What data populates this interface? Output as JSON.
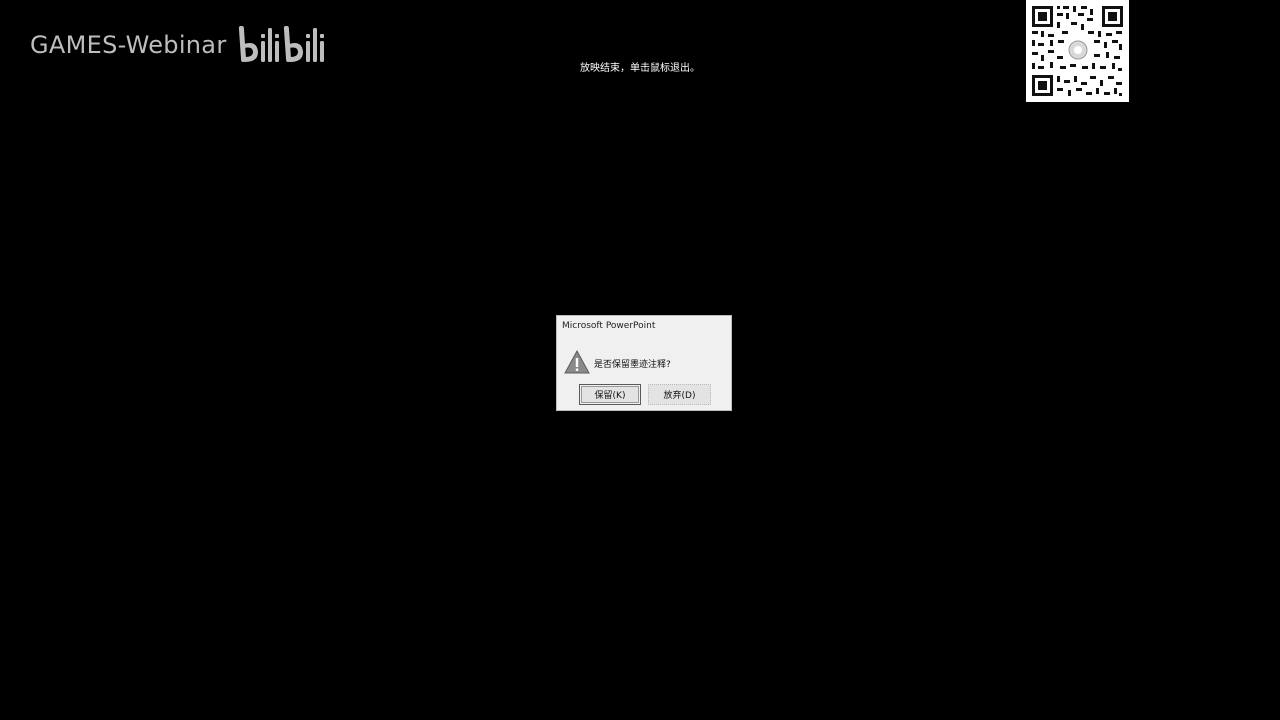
{
  "watermark": {
    "text": "GAMES-Webinar",
    "logo_text": "bilibili"
  },
  "slideshow": {
    "end_message": "放映结束，单击鼠标退出。"
  },
  "dialog": {
    "title": "Microsoft PowerPoint",
    "icon": "warning-icon",
    "message": "是否保留墨迹注释?",
    "keep_label": "保留(K)",
    "discard_label": "放弃(D)"
  },
  "colors": {
    "background": "#000000",
    "watermark": "#bdbdbd",
    "dialog_bg": "#f0f0f0"
  }
}
